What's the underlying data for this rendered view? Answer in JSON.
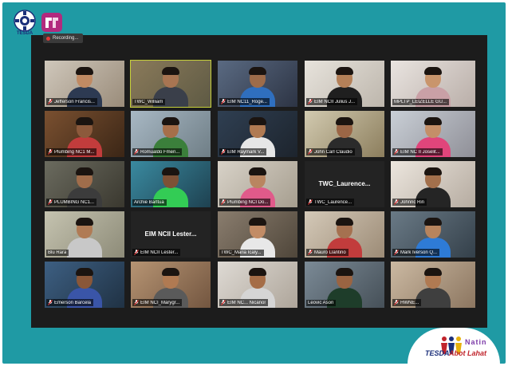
{
  "logos": {
    "tesda_caption": "TESDA",
    "badge": {
      "part1": "TESDA",
      "part2": "Abot Lahat",
      "script": "Natin"
    }
  },
  "meeting": {
    "recording_label": "Recording...",
    "tiles": [
      {
        "name": "Jefferson Francis...",
        "muted": true
      },
      {
        "name": "TWC_William",
        "muted": false,
        "active": true
      },
      {
        "name": "EIM NC11_Roge...",
        "muted": true
      },
      {
        "name": "EIM NCII Julius J...",
        "muted": true
      },
      {
        "name": "MPLTP_LEIZELLE GU...",
        "muted": false
      },
      {
        "name": "Plumbing NC1 M...",
        "muted": true
      },
      {
        "name": "Romualdo Fmen...",
        "muted": true
      },
      {
        "name": "EIM Raymark V...",
        "muted": true
      },
      {
        "name": "John Carl Claudio",
        "muted": true
      },
      {
        "name": "EIM NC II Joselit...",
        "muted": true
      },
      {
        "name": "PLUMBING NC1...",
        "muted": true
      },
      {
        "name": "Archie Barltua",
        "muted": false
      },
      {
        "name": "Plumbing NCI Do...",
        "muted": true
      },
      {
        "name": "TWC_Laurence...",
        "muted": true,
        "text_only": true
      },
      {
        "name": "Johnric Rin",
        "muted": true
      },
      {
        "name": "Blu Rara",
        "muted": false
      },
      {
        "name": "EIM NCII Lester...",
        "muted": true,
        "text_only": true
      },
      {
        "name": "TWC_Maria Icaly...",
        "muted": false
      },
      {
        "name": "Mauro Llantino",
        "muted": true
      },
      {
        "name": "Mark Iverson Q...",
        "muted": true
      },
      {
        "name": "Emerson Barcela",
        "muted": true
      },
      {
        "name": "EIM NCI_Marygr...",
        "muted": true
      },
      {
        "name": "EIM NC... Nicanor",
        "muted": true
      },
      {
        "name": "Leovic Ason",
        "muted": false
      },
      {
        "name": "HWNE...",
        "muted": true
      }
    ]
  },
  "colors": {
    "frame": "#1f9aa4",
    "zoom_background": "#1c1c1c",
    "active_speaker": "#c7d13b",
    "muted_mic": "#e23a3a"
  }
}
